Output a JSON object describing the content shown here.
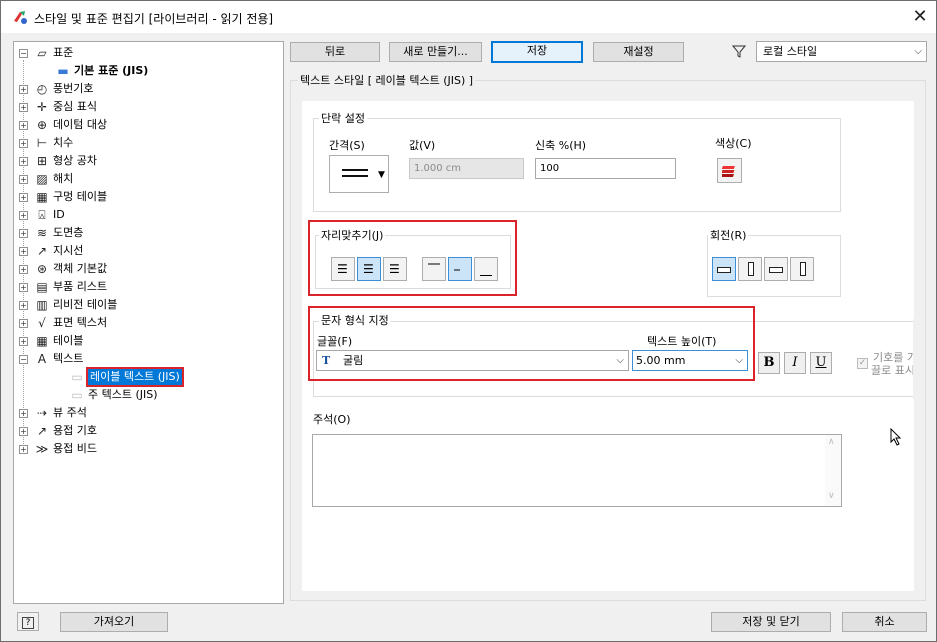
{
  "window": {
    "title": "스타일 및 표준 편집기 [라이브러리 - 읽기 전용]"
  },
  "tree": {
    "root": "표준",
    "root_child": "기본 표준 (JIS)",
    "items": [
      "풍번기호",
      "중심 표식",
      "데이텀 대상",
      "치수",
      "형상 공차",
      "해치",
      "구멍 테이블",
      "ID",
      "도면층",
      "지시선",
      "객체 기본값",
      "부품 리스트",
      "리비전 테이블",
      "표면 텍스처",
      "테이블",
      "텍스트"
    ],
    "text_children": [
      "레이블 텍스트 (JIS)",
      "주 텍스트 (JIS)"
    ],
    "after": [
      "뷰 주석",
      "용접 기호",
      "용접 비드"
    ]
  },
  "toolbar": {
    "back": "뒤로",
    "new": "새로 만들기...",
    "save": "저장",
    "reset": "재설정",
    "filter_value": "로컬 스타일"
  },
  "panel": {
    "header": "텍스트 스타일 [ 레이블 텍스트 (JIS) ]"
  },
  "paragraph": {
    "title": "단락 설정",
    "spacing_label": "간격(S)",
    "value_label": "값(V)",
    "value": "1.000 cm",
    "stretch_label": "신축 %(H)",
    "stretch_value": "100",
    "color_label": "색상(C)"
  },
  "justify": {
    "title": "자리맞추기(J)"
  },
  "rotate": {
    "title": "회전(R)"
  },
  "charfmt": {
    "title": "문자 형식 지정",
    "font_label": "글꼴(F)",
    "font_value": "굴림",
    "height_label": "텍스트 높이(T)",
    "height_value": "5.00 mm",
    "bold": "B",
    "italic": "I",
    "underline": "U",
    "symbol_line1": "기호를 가",
    "symbol_line2": "끌로 표시"
  },
  "comment": {
    "label": "주석(O)"
  },
  "footer": {
    "help": "?",
    "import": "가져오기",
    "save_close": "저장 및 닫기",
    "cancel": "취소"
  }
}
